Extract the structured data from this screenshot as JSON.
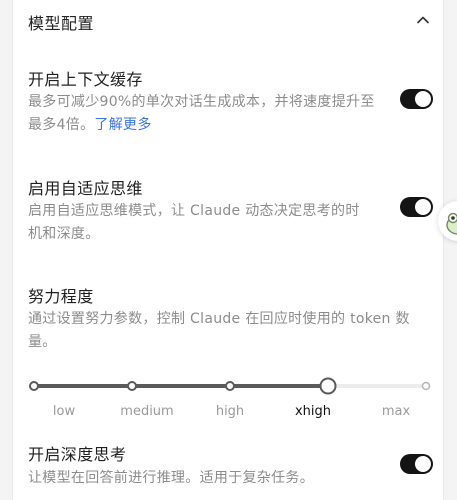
{
  "section": {
    "title": "模型配置",
    "collapse_icon": "chevron-up-icon"
  },
  "settings": [
    {
      "title": "开启上下文缓存",
      "desc_lines": [
        "最多可减少90%的单次对话生成成本，并将速度提升至",
        "最多4倍。"
      ],
      "link": "了解更多",
      "enabled": true
    },
    {
      "title": "启用自适应思维",
      "desc_lines": [
        "启用自适应思维模式，让 Claude 动态决定思考的时",
        "机和深度。"
      ],
      "enabled": true
    },
    {
      "title": "努力程度",
      "desc_lines": [
        "通过设置努力参数，控制 Claude 在回应时使用的 token 数",
        "量。"
      ]
    },
    {
      "title": "开启深度思考",
      "desc_lines": [
        "让模型在回答前进行推理。适用于复杂任务。"
      ],
      "enabled": true
    }
  ],
  "effort": {
    "levels": [
      "low",
      "medium",
      "high",
      "xhigh",
      "max"
    ],
    "selected": "xhigh"
  },
  "colors": {
    "toggle_on": "#141414",
    "link": "#3b73e6",
    "muted_text": "#8c8c8c",
    "slider_active": "#5a5a5a",
    "slider_inactive": "#e6e6e6"
  },
  "side_widget": {
    "icon": "mascot-icon"
  }
}
